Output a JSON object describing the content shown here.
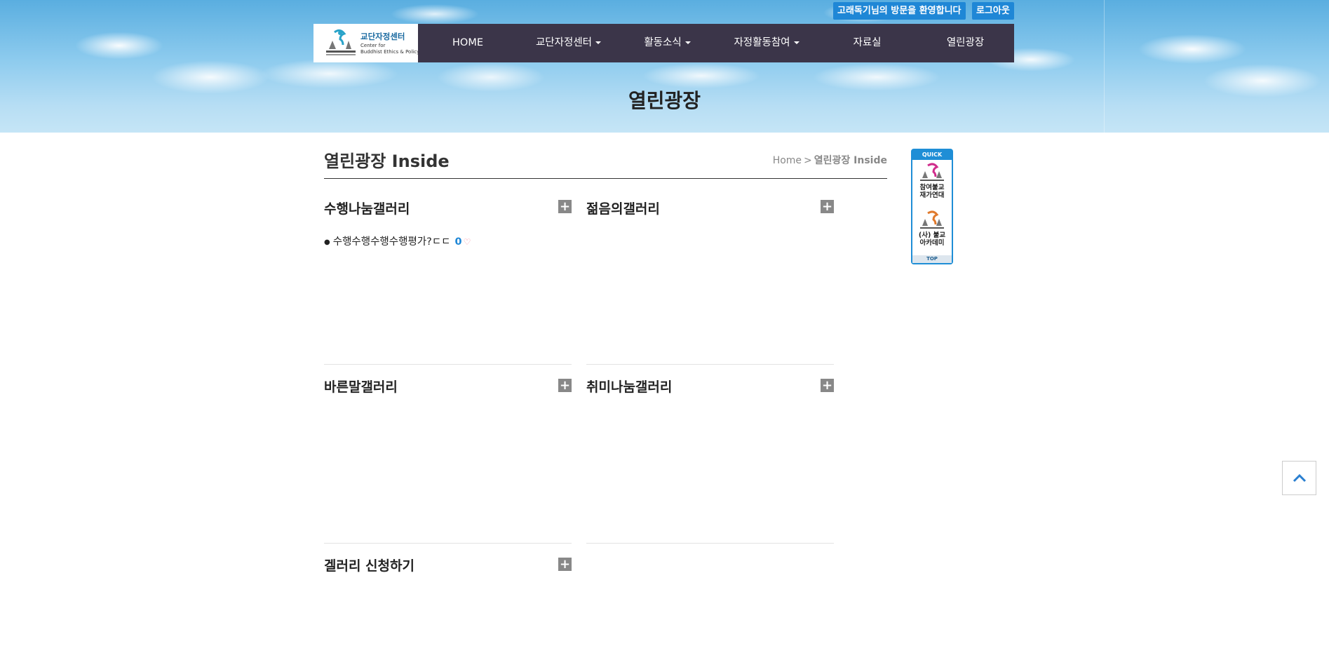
{
  "header": {
    "welcome_message": "고래독기님의 방문을 환영합니다",
    "logout_label": "로그아웃",
    "logo": {
      "ko": "교단자정센터",
      "en_line1": "Center for",
      "en_line2": "Buddhist Ethics & Policy"
    },
    "nav": [
      {
        "label": "HOME",
        "has_dropdown": false
      },
      {
        "label": "교단자정센터",
        "has_dropdown": true
      },
      {
        "label": "활동소식",
        "has_dropdown": true
      },
      {
        "label": "자정활동참여",
        "has_dropdown": true
      },
      {
        "label": "자료실",
        "has_dropdown": false
      },
      {
        "label": "열린광장",
        "has_dropdown": false
      }
    ],
    "banner_title": "열린광장"
  },
  "main": {
    "page_title": "열린광장 Inside",
    "breadcrumb": {
      "home": "Home",
      "separator": ">",
      "current": "열린광장 Inside"
    },
    "sections": [
      {
        "title": "수행나눔갤러리",
        "more_label": "+",
        "posts": [
          {
            "title": "수행수행수행수행평가?ㄷㄷ",
            "count": "0"
          }
        ]
      },
      {
        "title": "젊음의갤러리",
        "more_label": "+",
        "posts": []
      },
      {
        "title": "바른말갤러리",
        "more_label": "+",
        "posts": []
      },
      {
        "title": "취미나눔갤러리",
        "more_label": "+",
        "posts": []
      },
      {
        "title": "겔러리 신청하기",
        "more_label": "+",
        "posts": []
      }
    ]
  },
  "quick_menu": {
    "header": "QUICK",
    "links": [
      {
        "label_line1": "참여불교",
        "label_line2": "재가연대"
      },
      {
        "label_line1": "(사) 불교",
        "label_line2": "아카데미"
      }
    ],
    "top_label": "TOP"
  },
  "colors": {
    "nav_bg": "#3b3549",
    "accent_blue": "#1f87d6",
    "plus_button": "#888888"
  },
  "icons": [
    "caret-down-icon",
    "plus-icon",
    "heart-icon",
    "chevron-up-icon"
  ]
}
